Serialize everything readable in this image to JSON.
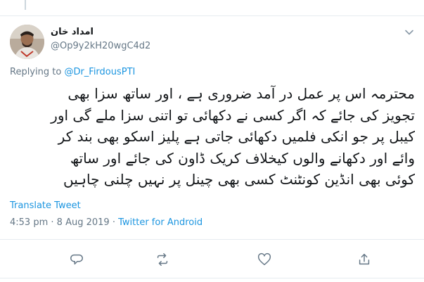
{
  "tweet": {
    "author": {
      "display_name": "امداد خان",
      "handle": "@Op9y2kH20wgC4d2"
    },
    "replying_label": "Replying to",
    "replying_to": "@Dr_FirdousPTI",
    "text_lines": [
      "محترمہ اس پر عمل در آمد ضروری ہے ، اور ساتھ سزا بھی",
      "تجویز کی جائے کہ اگر کسی نے دکھائی تو اتنی سزا ملے گی اور",
      "کیبل پر جو انکی فلمیں دکھائی جاتی ہے پلیز اسکو بھی بند کر",
      "وائے اور دکھانے والوں کیخلاف کریک ڈاون کی جائے  اور ساتھ",
      "کوئی بھی انڈین کونٹنٹ کسی بھی چینل پر نہیں چلنی چاہیں"
    ],
    "translate_label": "Translate Tweet",
    "time": "4:53 pm",
    "date": "8 Aug 2019",
    "separator": "·",
    "source": "Twitter for Android"
  },
  "icons": {
    "menu": "chevron-down-icon",
    "reply": "reply-icon",
    "retweet": "retweet-icon",
    "like": "like-icon",
    "share": "share-icon"
  },
  "colors": {
    "link": "#1b95e0",
    "secondary_text": "#657786",
    "primary_text": "#14171a",
    "divider": "#e6ecf0"
  }
}
